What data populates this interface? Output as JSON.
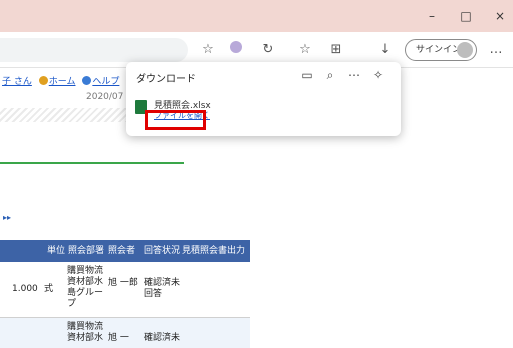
{
  "window": {
    "minimize": "–",
    "maximize": "□",
    "close": "×"
  },
  "toolbar": {
    "signin_label": "サインイン",
    "more_label": "…",
    "icons": [
      "favorite-star-icon",
      "extension-icon",
      "refresh-icon",
      "favorites-icon",
      "collections-icon",
      "download-icon"
    ]
  },
  "page": {
    "nav": {
      "user_suffix": "子 さん",
      "home": "ホーム",
      "help": "ヘルプ"
    },
    "date": "2020/07",
    "pager_arrows": "▸▸",
    "table": {
      "headers": [
        "単位",
        "照会部署",
        "照会者",
        "回答状況",
        "見積照会書出力日"
      ],
      "rows": [
        {
          "qty": "1.000",
          "unit": "式",
          "dept": "購買物流資材部水島グループ",
          "person": "旭 一郎",
          "status": "確認済未回答"
        },
        {
          "qty": "",
          "unit": "",
          "dept": "購買物流資材部水",
          "person": "旭 一",
          "status": "確認済未"
        }
      ]
    }
  },
  "downloads": {
    "title": "ダウンロード",
    "actions": [
      "folder-icon",
      "search-icon",
      "more-icon",
      "pin-icon"
    ],
    "file_name": "見積照会.xlsx",
    "open_file_label": "ファイルを開く"
  }
}
